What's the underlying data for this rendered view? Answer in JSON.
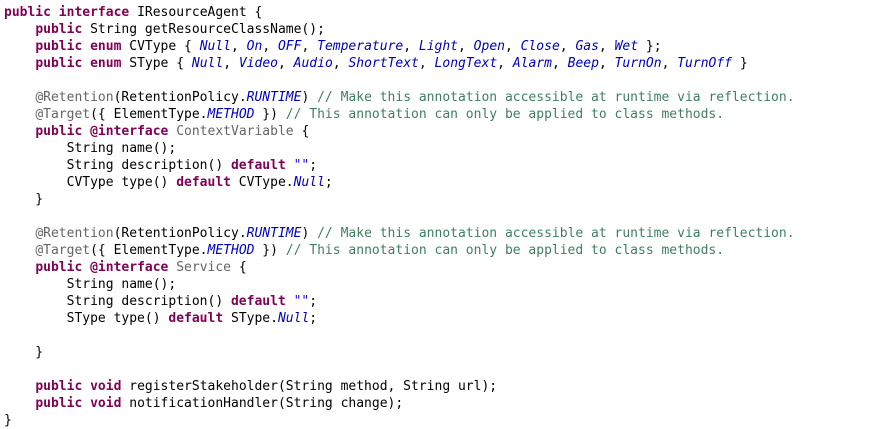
{
  "editor": {
    "lines": [
      [
        {
          "t": "public",
          "c": "keyword"
        },
        {
          "t": " "
        },
        {
          "t": "interface",
          "c": "keyword"
        },
        {
          "t": " IResourceAgent {"
        }
      ],
      [
        {
          "t": "    "
        },
        {
          "t": "public",
          "c": "keyword"
        },
        {
          "t": " String getResourceClassName();"
        }
      ],
      [
        {
          "t": "    "
        },
        {
          "t": "public",
          "c": "keyword"
        },
        {
          "t": " "
        },
        {
          "t": "enum",
          "c": "keyword"
        },
        {
          "t": " CVType { "
        },
        {
          "t": "Null",
          "c": "enum"
        },
        {
          "t": ", "
        },
        {
          "t": "On",
          "c": "enum"
        },
        {
          "t": ", "
        },
        {
          "t": "OFF",
          "c": "enum"
        },
        {
          "t": ", "
        },
        {
          "t": "Temperature",
          "c": "enum"
        },
        {
          "t": ", "
        },
        {
          "t": "Light",
          "c": "enum"
        },
        {
          "t": ", "
        },
        {
          "t": "Open",
          "c": "enum"
        },
        {
          "t": ", "
        },
        {
          "t": "Close",
          "c": "enum"
        },
        {
          "t": ", "
        },
        {
          "t": "Gas",
          "c": "enum"
        },
        {
          "t": ", "
        },
        {
          "t": "Wet",
          "c": "enum"
        },
        {
          "t": " };"
        }
      ],
      [
        {
          "t": "    "
        },
        {
          "t": "public",
          "c": "keyword"
        },
        {
          "t": " "
        },
        {
          "t": "enum",
          "c": "keyword"
        },
        {
          "t": " SType { "
        },
        {
          "t": "Null",
          "c": "enum"
        },
        {
          "t": ", "
        },
        {
          "t": "Video",
          "c": "enum"
        },
        {
          "t": ", "
        },
        {
          "t": "Audio",
          "c": "enum"
        },
        {
          "t": ", "
        },
        {
          "t": "ShortText",
          "c": "enum"
        },
        {
          "t": ", "
        },
        {
          "t": "LongText",
          "c": "enum"
        },
        {
          "t": ", "
        },
        {
          "t": "Alarm",
          "c": "enum"
        },
        {
          "t": ", "
        },
        {
          "t": "Beep",
          "c": "enum"
        },
        {
          "t": ", "
        },
        {
          "t": "TurnOn",
          "c": "enum"
        },
        {
          "t": ", "
        },
        {
          "t": "TurnOff",
          "c": "enum"
        },
        {
          "t": " }"
        }
      ],
      [],
      [
        {
          "t": "    "
        },
        {
          "t": "@Retention",
          "c": "annotation"
        },
        {
          "t": "(RetentionPolicy."
        },
        {
          "t": "RUNTIME",
          "c": "enum"
        },
        {
          "t": ") "
        },
        {
          "t": "// Make this annotation accessible at runtime via reflection.",
          "c": "comment"
        }
      ],
      [
        {
          "t": "    "
        },
        {
          "t": "@Target",
          "c": "annotation"
        },
        {
          "t": "({ ElementType."
        },
        {
          "t": "METHOD",
          "c": "enum"
        },
        {
          "t": " }) "
        },
        {
          "t": "// This annotation can only be applied to class methods.",
          "c": "comment"
        }
      ],
      [
        {
          "t": "    "
        },
        {
          "t": "public",
          "c": "keyword"
        },
        {
          "t": " "
        },
        {
          "t": "@interface",
          "c": "keyword"
        },
        {
          "t": " "
        },
        {
          "t": "ContextVariable",
          "c": "annotation"
        },
        {
          "t": " {"
        }
      ],
      [
        {
          "t": "        String name();"
        }
      ],
      [
        {
          "t": "        String description() "
        },
        {
          "t": "default",
          "c": "keyword"
        },
        {
          "t": " "
        },
        {
          "t": "\"\"",
          "c": "string"
        },
        {
          "t": ";"
        }
      ],
      [
        {
          "t": "        CVType type() "
        },
        {
          "t": "default",
          "c": "keyword"
        },
        {
          "t": " CVType."
        },
        {
          "t": "Null",
          "c": "enum"
        },
        {
          "t": ";"
        }
      ],
      [
        {
          "t": "    }"
        }
      ],
      [],
      [
        {
          "t": "    "
        },
        {
          "t": "@Retention",
          "c": "annotation"
        },
        {
          "t": "(RetentionPolicy."
        },
        {
          "t": "RUNTIME",
          "c": "enum"
        },
        {
          "t": ") "
        },
        {
          "t": "// Make this annotation accessible at runtime via reflection.",
          "c": "comment"
        }
      ],
      [
        {
          "t": "    "
        },
        {
          "t": "@Target",
          "c": "annotation"
        },
        {
          "t": "({ ElementType."
        },
        {
          "t": "METHOD",
          "c": "enum"
        },
        {
          "t": " }) "
        },
        {
          "t": "// This annotation can only be applied to class methods.",
          "c": "comment"
        }
      ],
      [
        {
          "t": "    "
        },
        {
          "t": "public",
          "c": "keyword"
        },
        {
          "t": " "
        },
        {
          "t": "@interface",
          "c": "keyword"
        },
        {
          "t": " "
        },
        {
          "t": "Service",
          "c": "annotation"
        },
        {
          "t": " {"
        }
      ],
      [
        {
          "t": "        String name();"
        }
      ],
      [
        {
          "t": "        String description() "
        },
        {
          "t": "default",
          "c": "keyword"
        },
        {
          "t": " "
        },
        {
          "t": "\"\"",
          "c": "string"
        },
        {
          "t": ";"
        }
      ],
      [
        {
          "t": "        SType type() "
        },
        {
          "t": "default",
          "c": "keyword"
        },
        {
          "t": " SType."
        },
        {
          "t": "Null",
          "c": "enum"
        },
        {
          "t": ";"
        }
      ],
      [],
      [
        {
          "t": "    }"
        }
      ],
      [],
      [
        {
          "t": "    "
        },
        {
          "t": "public",
          "c": "keyword"
        },
        {
          "t": " "
        },
        {
          "t": "void",
          "c": "keyword"
        },
        {
          "t": " registerStakeholder(String method, String url);"
        }
      ],
      [
        {
          "t": "    "
        },
        {
          "t": "public",
          "c": "keyword"
        },
        {
          "t": " "
        },
        {
          "t": "void",
          "c": "keyword"
        },
        {
          "t": " notificationHandler(String change);"
        }
      ],
      [
        {
          "t": "}"
        }
      ]
    ]
  },
  "colors": {
    "background": "#ffffff",
    "keyword": "#7f0055",
    "enum_constant": "#0000c0",
    "annotation": "#646464",
    "comment": "#3f7f5f",
    "string": "#2a00ff",
    "plain": "#000000"
  }
}
